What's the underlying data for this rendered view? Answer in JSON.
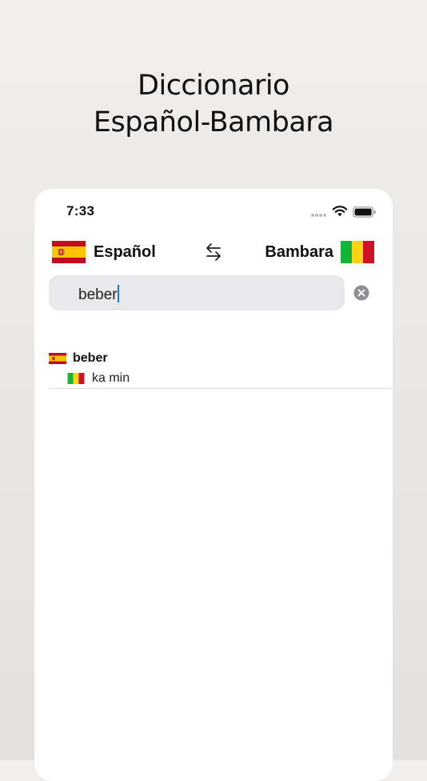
{
  "headline": {
    "line1": "Diccionario",
    "line2": "Español-Bambara"
  },
  "status_bar": {
    "time": "7:33",
    "icons": [
      "cellular-signal-icon",
      "wifi-icon",
      "battery-icon"
    ]
  },
  "languages": {
    "source": "Español",
    "target": "Bambara",
    "source_flag": "spain-flag-icon",
    "target_flag": "mali-flag-icon",
    "swap_icon": "swap-arrows-icon"
  },
  "search": {
    "value": "beber",
    "clear_icon": "clear-icon"
  },
  "results": [
    {
      "word": "beber",
      "translation": "ka min"
    }
  ],
  "colors": {
    "spain_red": "#c60b1e",
    "spain_yellow": "#ffc400",
    "mali_green": "#14b53a",
    "mali_yellow": "#fcd116",
    "mali_red": "#ce1126",
    "caret_blue": "#1677e8",
    "search_bg": "#e9e9eb"
  }
}
